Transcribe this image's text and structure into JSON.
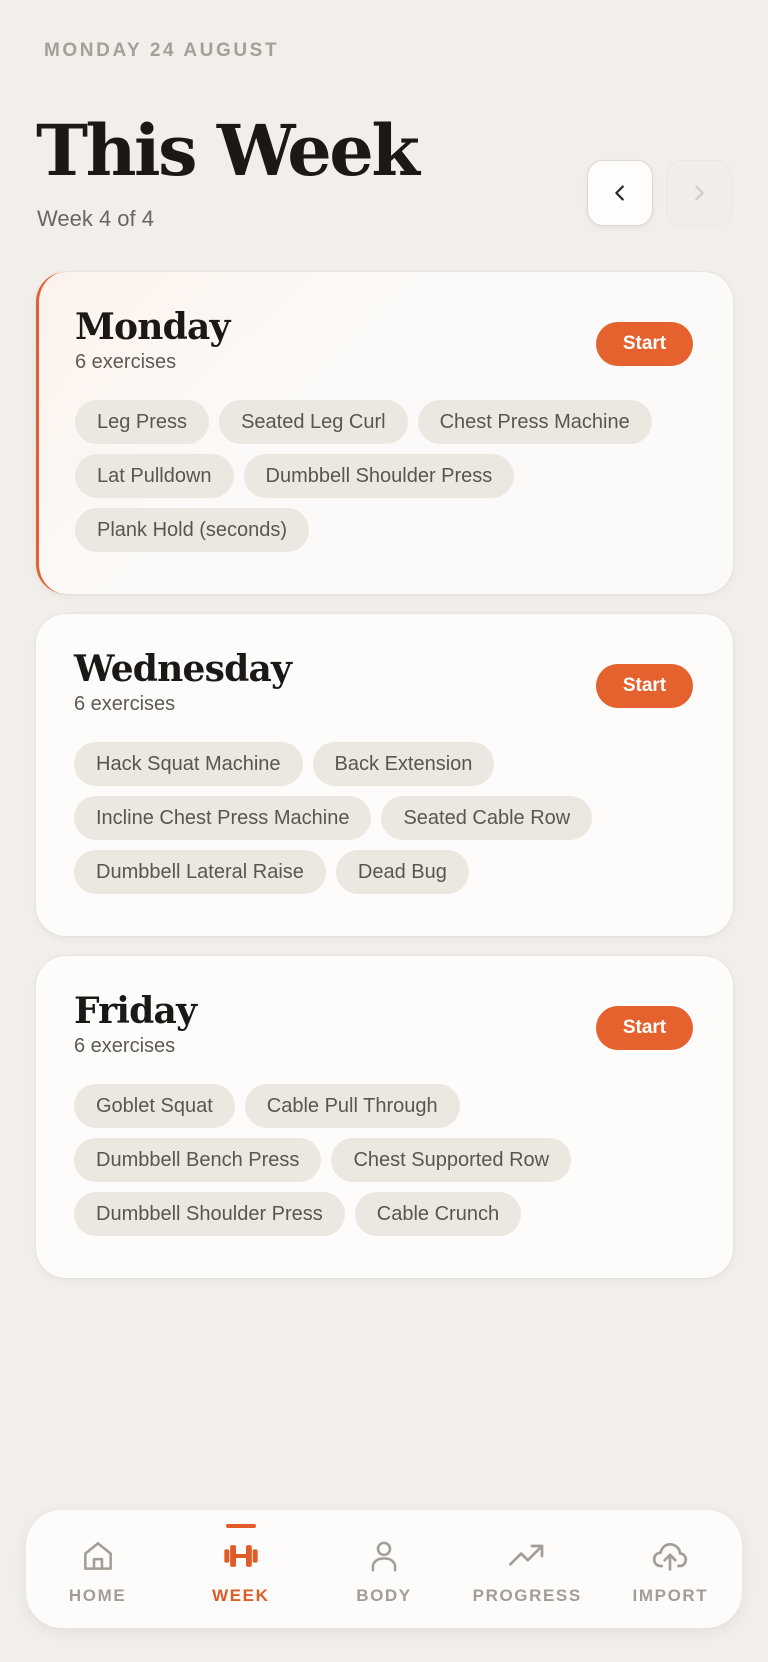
{
  "header": {
    "date": "MONDAY 24 AUGUST",
    "title": "This Week",
    "subtitle": "Week 4 of 4",
    "prev_icon": "chevron-left-icon",
    "next_icon": "chevron-right-icon"
  },
  "days": [
    {
      "name": "Monday",
      "count": "6 exercises",
      "start_label": "Start",
      "exercises": [
        "Leg Press",
        "Seated Leg Curl",
        "Chest Press Machine",
        "Lat Pulldown",
        "Dumbbell Shoulder Press",
        "Plank Hold (seconds)"
      ]
    },
    {
      "name": "Wednesday",
      "count": "6 exercises",
      "start_label": "Start",
      "exercises": [
        "Hack Squat Machine",
        "Back Extension",
        "Incline Chest Press Machine",
        "Seated Cable Row",
        "Dumbbell Lateral Raise",
        "Dead Bug"
      ]
    },
    {
      "name": "Friday",
      "count": "6 exercises",
      "start_label": "Start",
      "exercises": [
        "Goblet Squat",
        "Cable Pull Through",
        "Dumbbell Bench Press",
        "Chest Supported Row",
        "Dumbbell Shoulder Press",
        "Cable Crunch"
      ]
    }
  ],
  "tabs": [
    {
      "label": "HOME",
      "icon": "home-icon"
    },
    {
      "label": "WEEK",
      "icon": "dumbbell-icon"
    },
    {
      "label": "BODY",
      "icon": "person-icon"
    },
    {
      "label": "PROGRESS",
      "icon": "trend-up-icon"
    },
    {
      "label": "IMPORT",
      "icon": "cloud-upload-icon"
    }
  ],
  "colors": {
    "accent": "#e5622f",
    "background": "#f2efeb",
    "chip": "#ece7e0"
  }
}
